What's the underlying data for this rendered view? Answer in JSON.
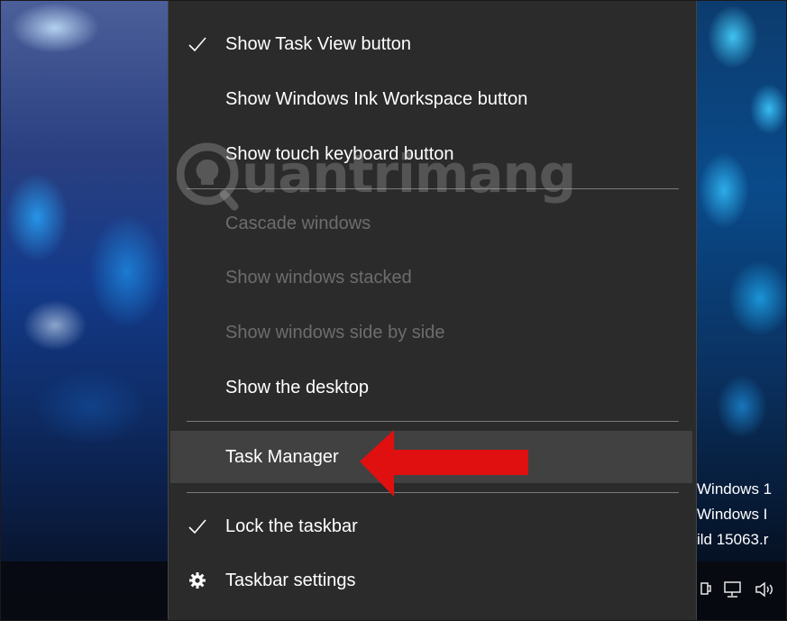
{
  "menu": {
    "items": [
      {
        "label": "Show Task View button",
        "checked": true,
        "enabled": true
      },
      {
        "label": "Show Windows Ink Workspace button",
        "checked": false,
        "enabled": true
      },
      {
        "label": "Show touch keyboard button",
        "checked": false,
        "enabled": true
      },
      {
        "label": "Cascade windows",
        "checked": false,
        "enabled": false
      },
      {
        "label": "Show windows stacked",
        "checked": false,
        "enabled": false
      },
      {
        "label": "Show windows side by side",
        "checked": false,
        "enabled": false
      },
      {
        "label": "Show the desktop",
        "checked": false,
        "enabled": true
      },
      {
        "label": "Task Manager",
        "checked": false,
        "enabled": true,
        "highlighted": true
      },
      {
        "label": "Lock the taskbar",
        "checked": true,
        "enabled": true
      },
      {
        "label": "Taskbar settings",
        "icon": "gear-icon",
        "enabled": true
      }
    ]
  },
  "watermark": {
    "brand": "uantrimang",
    "desktop_lines": [
      "Windows 1",
      "Windows I",
      "ild 15063.r"
    ]
  },
  "colors": {
    "menu_bg": "#2b2b2b",
    "highlight_bg": "#414141",
    "text": "#ffffff",
    "disabled_text": "#6d6d6d",
    "arrow": "#e01010"
  },
  "tray_icons": [
    "tablet-icon",
    "network-icon",
    "volume-icon"
  ]
}
